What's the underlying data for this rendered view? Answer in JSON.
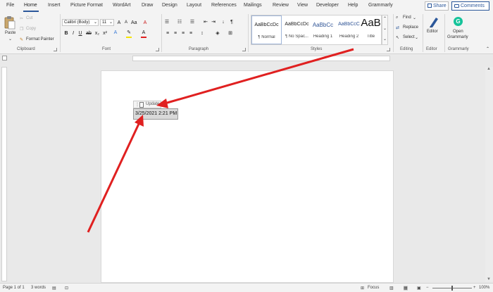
{
  "menu": {
    "tabs": [
      "File",
      "Home",
      "Insert",
      "Picture Format",
      "WordArt",
      "Draw",
      "Design",
      "Layout",
      "References",
      "Mailings",
      "Review",
      "View",
      "Developer",
      "Help",
      "Grammarly"
    ],
    "active_tab": "Home",
    "share_label": "Share",
    "comments_label": "Comments"
  },
  "ribbon": {
    "clipboard": {
      "paste": "Paste",
      "cut": "Cut",
      "copy": "Copy",
      "format_painter": "Format Painter",
      "label": "Clipboard"
    },
    "font": {
      "font_name": "Calibri (Body)",
      "font_size": "11",
      "label": "Font"
    },
    "paragraph": {
      "label": "Paragraph"
    },
    "styles": {
      "items": [
        {
          "sample": "AaBbCcDc",
          "name": "¶ Normal"
        },
        {
          "sample": "AaBbCcDc",
          "name": "¶ No Spac..."
        },
        {
          "sample": "AaBbCc",
          "name": "Heading 1"
        },
        {
          "sample": "AaBbCcC",
          "name": "Heading 2"
        },
        {
          "sample": "AaB",
          "name": "Title"
        }
      ],
      "label": "Styles"
    },
    "editing": {
      "find": "Find",
      "replace": "Replace",
      "select": "Select",
      "label": "Editing"
    },
    "editor": {
      "button": "Editor",
      "label": "Editor"
    },
    "grammarly": {
      "button_line1": "Open",
      "button_line2": "Grammarly",
      "label": "Grammarly"
    }
  },
  "document": {
    "field_toolbar_label": "Update",
    "field_value": "3/25/2021 2:21 PM"
  },
  "statusbar": {
    "page": "Page 1 of 1",
    "words": "3 words",
    "focus": "Focus",
    "zoom": "100%"
  },
  "colors": {
    "accent": "#2b579a",
    "arrow": "#e02020",
    "font_color_bar": "#e02020",
    "highlight_bar": "#f5e400",
    "grammarly": "#15c39a"
  }
}
